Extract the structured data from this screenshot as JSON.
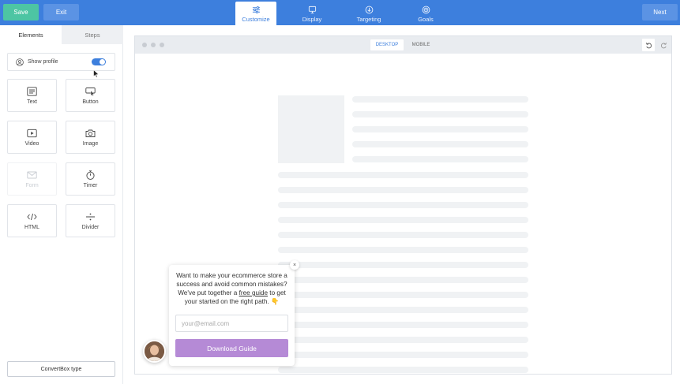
{
  "topbar": {
    "save_label": "Save",
    "exit_label": "Exit",
    "next_label": "Next",
    "tabs": [
      {
        "label": "Customize",
        "icon": "sliders-icon",
        "active": true
      },
      {
        "label": "Display",
        "icon": "monitor-icon",
        "active": false
      },
      {
        "label": "Targeting",
        "icon": "download-circle-icon",
        "active": false
      },
      {
        "label": "Goals",
        "icon": "target-icon",
        "active": false
      }
    ],
    "color": "#3d7fdd",
    "save_color": "#4dc5a3"
  },
  "sidebar": {
    "tabs": [
      {
        "label": "Elements",
        "active": true
      },
      {
        "label": "Steps",
        "active": false
      }
    ],
    "show_profile": {
      "label": "Show profile",
      "enabled": true
    },
    "elements": [
      {
        "label": "Text",
        "icon": "text-lines-icon",
        "enabled": true
      },
      {
        "label": "Button",
        "icon": "button-cursor-icon",
        "enabled": true
      },
      {
        "label": "Video",
        "icon": "play-icon",
        "enabled": true
      },
      {
        "label": "Image",
        "icon": "camera-icon",
        "enabled": true
      },
      {
        "label": "Form",
        "icon": "envelope-icon",
        "enabled": false
      },
      {
        "label": "Timer",
        "icon": "stopwatch-icon",
        "enabled": true
      },
      {
        "label": "HTML",
        "icon": "code-icon",
        "enabled": true
      },
      {
        "label": "Divider",
        "icon": "divider-icon",
        "enabled": true
      }
    ],
    "convertbox_type_label": "ConvertBox type"
  },
  "preview": {
    "view_modes": [
      {
        "label": "DESKTOP",
        "active": true
      },
      {
        "label": "MOBILE",
        "active": false
      }
    ]
  },
  "popup": {
    "text_before": "Want to make your ecommerce store a success and avoid common mistakes? We've put together a ",
    "link_text": "free guide",
    "text_after": " to get your started on the right path. 👇",
    "email_placeholder": "your@email.com",
    "button_label": "Download Guide",
    "button_color": "#b58ad6",
    "close_symbol": "×"
  }
}
